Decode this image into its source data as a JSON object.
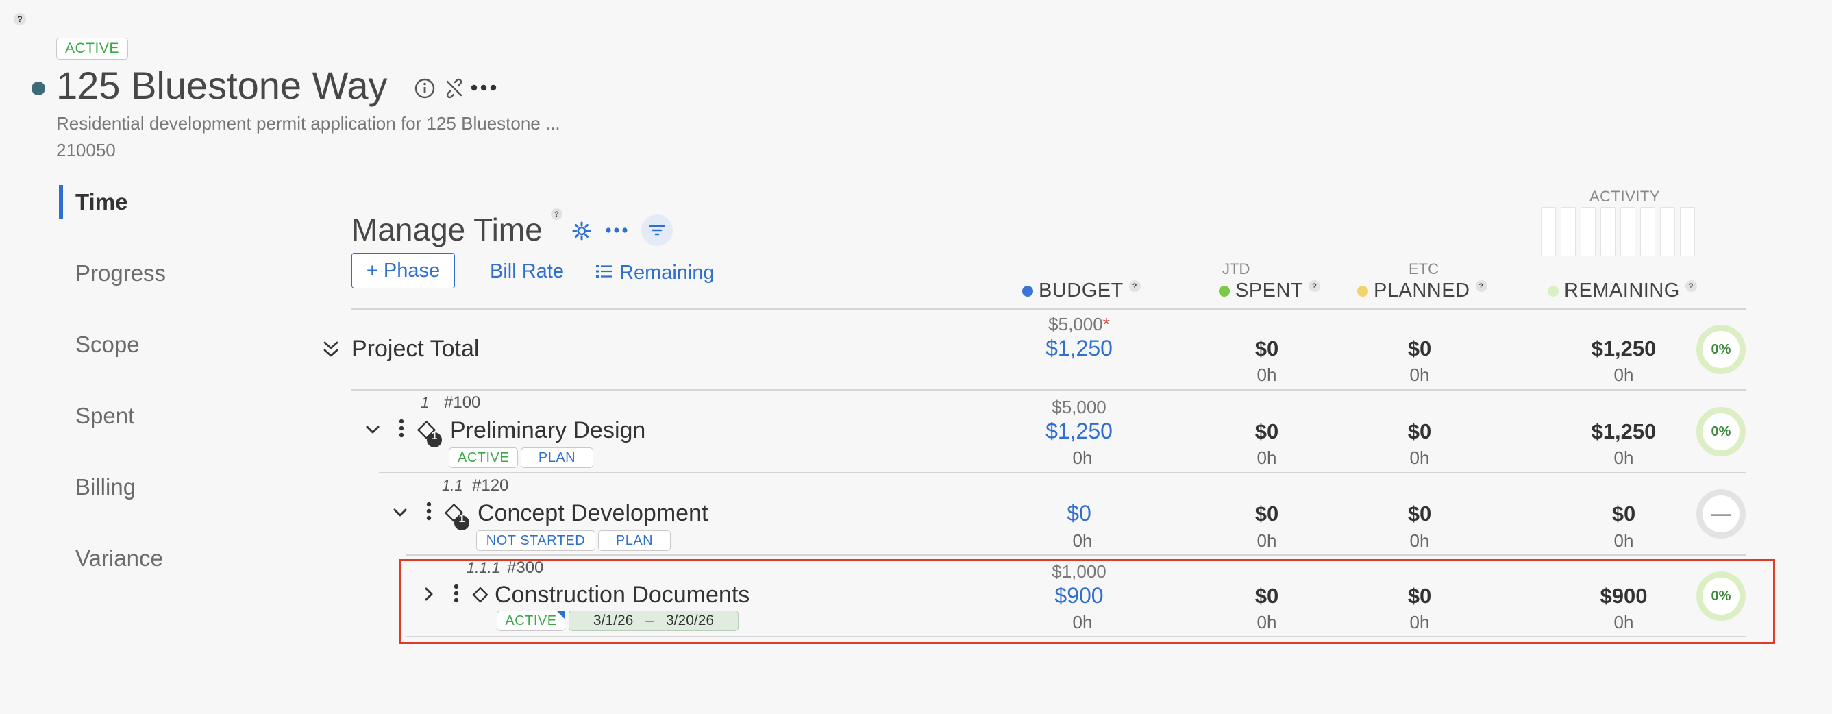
{
  "help": "?",
  "project": {
    "status": "ACTIVE",
    "title": "125 Bluestone Way",
    "description": "Residential development permit application for 125 Bluestone ...",
    "number": "210050"
  },
  "nav": {
    "items": [
      "Time",
      "Progress",
      "Scope",
      "Spent",
      "Billing",
      "Variance"
    ]
  },
  "manage": {
    "title": "Manage Time",
    "help": "?",
    "phase_button": "+ Phase",
    "bill_rate": "Bill Rate",
    "remaining": "Remaining"
  },
  "activity": {
    "label": "ACTIVITY"
  },
  "columns": {
    "budget": "BUDGET",
    "jtd": "JTD",
    "spent": "SPENT",
    "etc": "ETC",
    "planned": "PLANNED",
    "remaining": "REMAINING",
    "help": "?"
  },
  "colors": {
    "budget": "#3a76d8",
    "spent": "#7cc94a",
    "planned": "#f1d56a",
    "remaining": "#d9f0c6",
    "highlight": "#e03a2a"
  },
  "rows": {
    "total": {
      "name": "Project Total",
      "budget_top": "$5,000",
      "budget_star": "*",
      "budget": "$1,250",
      "spent": "$0",
      "spent_h": "0h",
      "planned": "$0",
      "planned_h": "0h",
      "remaining": "$1,250",
      "remaining_h": "0h",
      "pct": "0%"
    },
    "r1": {
      "index": "1",
      "num": "#100",
      "icon_count": "1",
      "name": "Preliminary Design",
      "badges": [
        "ACTIVE",
        "PLAN"
      ],
      "budget_top": "$5,000",
      "budget": "$1,250",
      "budget_h": "0h",
      "spent": "$0",
      "spent_h": "0h",
      "planned": "$0",
      "planned_h": "0h",
      "remaining": "$1,250",
      "remaining_h": "0h",
      "pct": "0%"
    },
    "r2": {
      "index": "1.1",
      "num": "#120",
      "icon_count": "1",
      "name": "Concept Development",
      "badges": [
        "NOT STARTED",
        "PLAN"
      ],
      "budget": "$0",
      "budget_h": "0h",
      "spent": "$0",
      "spent_h": "0h",
      "planned": "$0",
      "planned_h": "0h",
      "remaining": "$0",
      "remaining_h": "0h",
      "pct": "—"
    },
    "r3": {
      "index": "1.1.1",
      "num": "#300",
      "name": "Construction Documents",
      "badges": [
        "ACTIVE"
      ],
      "date_start": "3/1/26",
      "date_sep": "–",
      "date_end": "3/20/26",
      "budget_top": "$1,000",
      "budget": "$900",
      "budget_h": "0h",
      "spent": "$0",
      "spent_h": "0h",
      "planned": "$0",
      "planned_h": "0h",
      "remaining": "$900",
      "remaining_h": "0h",
      "pct": "0%"
    }
  }
}
